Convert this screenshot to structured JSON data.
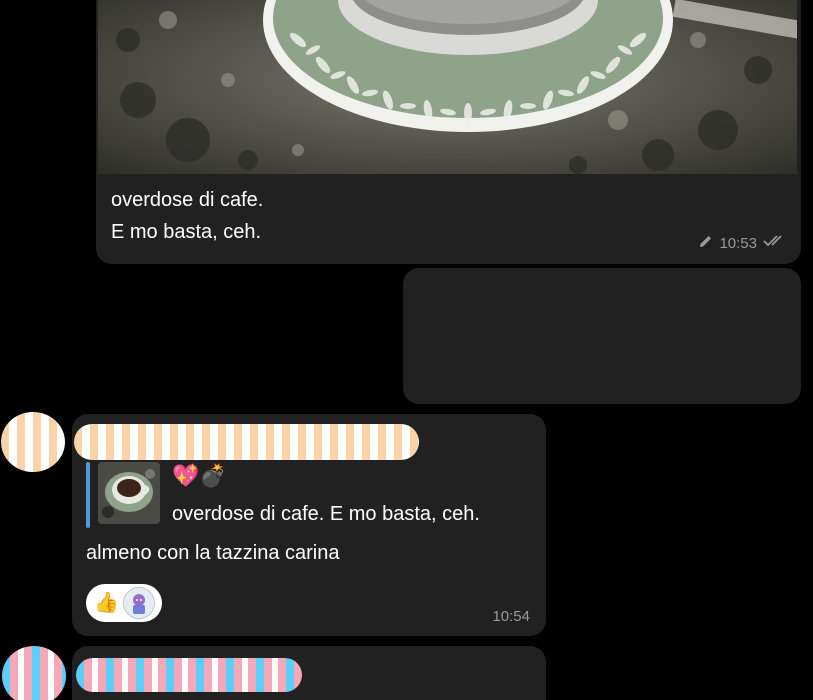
{
  "messages": {
    "photo_outgoing": {
      "caption_line1": "overdose di cafe.",
      "caption_line2": "E mo basta, ceh.",
      "time": "10:53",
      "edited_icon": "pencil-icon",
      "status_icon": "double-check-icon"
    },
    "empty_outgoing": {},
    "incoming": {
      "reply": {
        "emoji": "💖💣",
        "quote": "overdose di cafe. E mo basta, ceh."
      },
      "text": "almeno con la tazzina carina",
      "reactions": {
        "emoji": "👍",
        "reactor_icon": "reactor-avatar-icon"
      },
      "time": "10:54"
    }
  },
  "colors": {
    "background": "#000000",
    "bubble": "#212121",
    "meta_text": "#9a9a9a",
    "reply_bar": "#4b9ad6",
    "reaction_pill": "#ffffff"
  }
}
